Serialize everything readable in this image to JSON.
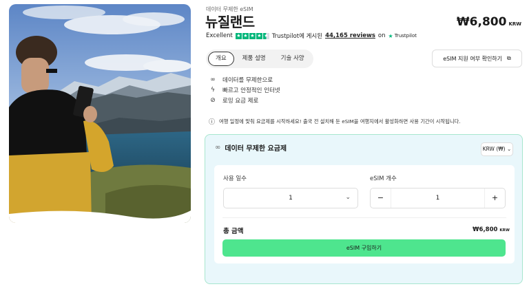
{
  "product": {
    "subtitle": "데이터 무제한 eSIM",
    "title": "뉴질랜드",
    "price": "₩6,800",
    "price_currency": "KRW"
  },
  "rating": {
    "label": "Excellent",
    "stars": 4.5,
    "brand": "Trustpilot에 게시된",
    "reviews": "44,165 reviews",
    "on": "on",
    "source": "Trustpilot"
  },
  "tabs": [
    {
      "label": "개요",
      "active": true
    },
    {
      "label": "제품 설명",
      "active": false
    },
    {
      "label": "기술 사양",
      "active": false
    }
  ],
  "check_button": {
    "label": "eSIM 지원 여부 확인하기",
    "icon": "copy-icon"
  },
  "features": [
    {
      "icon": "infinity-icon",
      "label": "데이터를 무제한으로"
    },
    {
      "icon": "lightning-icon",
      "label": "빠르고 안정적인 인터넷"
    },
    {
      "icon": "no-roaming-icon",
      "label": "로밍 요금 제로"
    }
  ],
  "notice": "여행 일정에 맞춰 요금제를 시작하세요! 출국 전 설치해 둔 eSIM을 여행지에서 활성화하면 사용 기간이 시작됩니다.",
  "plan": {
    "title": "데이터 무제한 요금제",
    "currency_select": "KRW (₩)",
    "days_label": "사용 일수",
    "days_value": "1",
    "esim_label": "eSIM 개수",
    "esim_value": "1",
    "minus": "−",
    "plus": "+",
    "total_label": "총 금액",
    "total_value": "₩6,800",
    "total_currency": "KRW",
    "buy_label": "eSIM 구입하기"
  },
  "colors": {
    "accent_green": "#4ee58e",
    "trustpilot_green": "#00b67a",
    "plan_bg": "#e9f7fb"
  }
}
